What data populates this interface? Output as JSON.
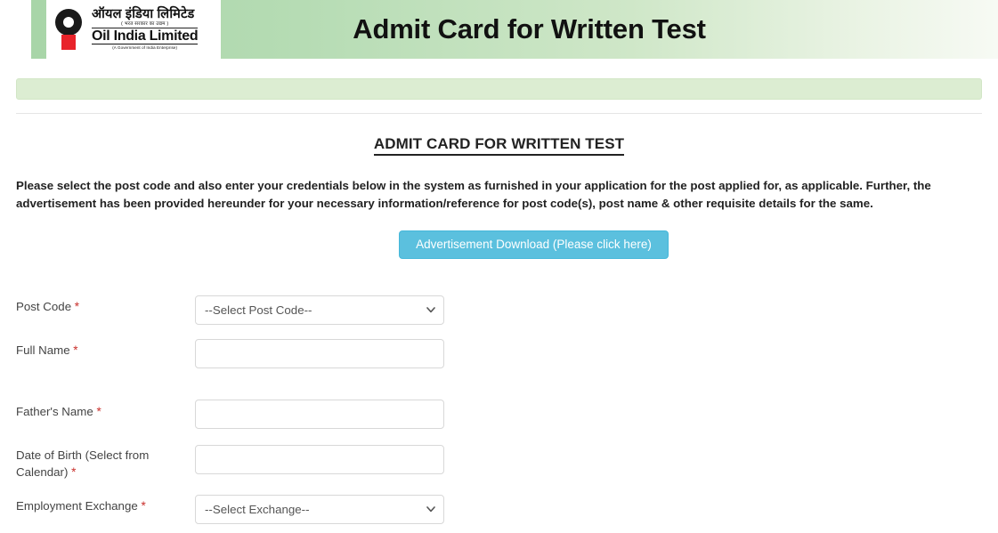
{
  "header": {
    "banner_title": "Admit Card for Written Test",
    "logo": {
      "icon": "oil-india-logo",
      "hindi_name": "ऑयल इंडिया लिमिटेड",
      "hindi_tagline": "( भरत सरकार का उद्यम )",
      "english_name": "Oil India Limited",
      "gov_line": "(A Government of India Enterprise)"
    }
  },
  "content": {
    "page_title": "ADMIT CARD FOR WRITTEN TEST",
    "intro_paragraph": "Please select the post code and also enter your credentials below in the system as furnished in your application for the post applied for, as applicable. Further, the advertisement has been provided hereunder for your necessary information/reference for post code(s), post name & other requisite details for the same.",
    "advertisement_button": "Advertisement Download (Please click here)"
  },
  "form": {
    "required_marker": "*",
    "fields": [
      {
        "label": "Post Code",
        "required": true,
        "type": "select",
        "value": "--Select Post Code--",
        "options": [
          "--Select Post Code--"
        ]
      },
      {
        "label": "Full Name",
        "required": true,
        "type": "text",
        "value": "",
        "placeholder": ""
      },
      {
        "label": "Father's Name",
        "required": true,
        "type": "text",
        "value": "",
        "placeholder": ""
      },
      {
        "label": "Date of Birth (Select from Calendar)",
        "required": true,
        "type": "text",
        "value": "",
        "placeholder": ""
      },
      {
        "label": "Employment Exchange",
        "required": true,
        "type": "select",
        "value": "--Select Exchange--",
        "options": [
          "--Select Exchange--"
        ]
      }
    ]
  },
  "colors": {
    "banner_green_start": "#a8d5a8",
    "banner_green_end": "#f7faf4",
    "nav_strip": "#dcedd2",
    "button_blue": "#5bc0de",
    "required_red": "#c9302c",
    "logo_red": "#e8232a"
  }
}
